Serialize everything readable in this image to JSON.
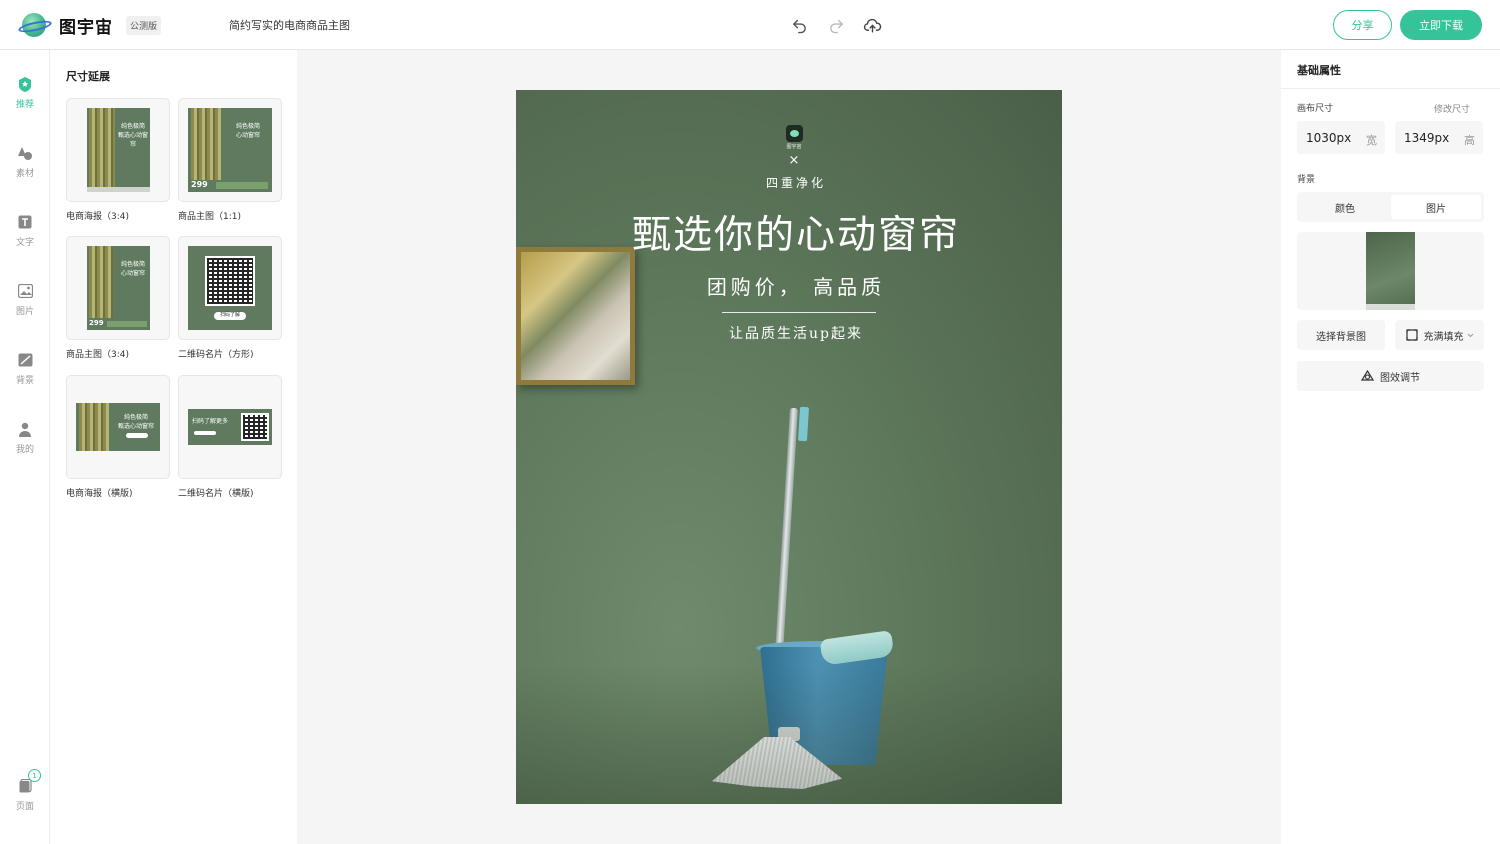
{
  "header": {
    "app_name": "图宇宙",
    "beta_label": "公测版",
    "doc_title": "简约写实的电商商品主图",
    "share_label": "分享",
    "download_label": "立即下载",
    "icons": [
      "undo-icon",
      "redo-icon",
      "cloud-upload-icon"
    ]
  },
  "rail": {
    "items": [
      {
        "label": "推荐",
        "icon": "star-badge-icon",
        "active": true
      },
      {
        "label": "素材",
        "icon": "shapes-icon"
      },
      {
        "label": "文字",
        "icon": "text-icon"
      },
      {
        "label": "图片",
        "icon": "image-icon"
      },
      {
        "label": "背景",
        "icon": "background-icon"
      },
      {
        "label": "我的",
        "icon": "user-icon"
      }
    ],
    "pages_label": "页面",
    "pages_count": "1"
  },
  "panel": {
    "title": "尺寸延展",
    "templates": [
      {
        "label": "电商海报（3:4)",
        "thumb_text": "纯色极简\n甄选心动窗帘"
      },
      {
        "label": "商品主图（1:1)",
        "thumb_text": "纯色极简\n心动窗帘",
        "price": "299"
      },
      {
        "label": "商品主图（3:4)",
        "thumb_text": "纯色极简\n心动窗帘",
        "price": "299"
      },
      {
        "label": "二维码名片（方形)",
        "thumb_text": "扫码了解"
      },
      {
        "label": "电商海报（横版)",
        "thumb_text": "纯色极简\n甄选心动窗帘"
      },
      {
        "label": "二维码名片（横版)",
        "thumb_text": "扫码了解更多"
      }
    ]
  },
  "poster": {
    "logo_text": "图宇宙",
    "cross": "×",
    "line1": "四重净化",
    "headline": "甄选你的心动窗帘",
    "subline": "团购价， 高品质",
    "tagline": "让品质生活up起来"
  },
  "right": {
    "title": "基础属性",
    "canvas_size_label": "画布尺寸",
    "modify_size_label": "修改尺寸",
    "width_value": "1030px",
    "width_unit": "宽",
    "height_value": "1349px",
    "height_unit": "高",
    "background_label": "背景",
    "tab_color": "颜色",
    "tab_image": "图片",
    "select_bg_label": "选择背景图",
    "fill_label": "充满填充",
    "effect_label": "图效调节"
  },
  "colors": {
    "accent": "#35c39a",
    "poster_bg": "#5f7a5d"
  }
}
